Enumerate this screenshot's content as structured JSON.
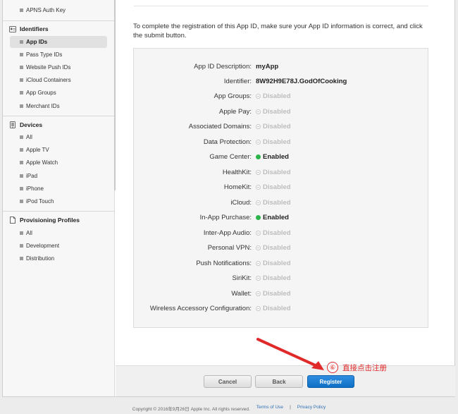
{
  "sidebar": {
    "top_items": [
      {
        "label": "APNS Auth Key"
      }
    ],
    "identifiers": {
      "title": "Identifiers",
      "items": [
        {
          "label": "App IDs",
          "active": true
        },
        {
          "label": "Pass Type IDs"
        },
        {
          "label": "Website Push IDs"
        },
        {
          "label": "iCloud Containers"
        },
        {
          "label": "App Groups"
        },
        {
          "label": "Merchant IDs"
        }
      ]
    },
    "devices": {
      "title": "Devices",
      "items": [
        {
          "label": "All"
        },
        {
          "label": "Apple TV"
        },
        {
          "label": "Apple Watch"
        },
        {
          "label": "iPad"
        },
        {
          "label": "iPhone"
        },
        {
          "label": "iPod Touch"
        }
      ]
    },
    "profiles": {
      "title": "Provisioning Profiles",
      "items": [
        {
          "label": "All"
        },
        {
          "label": "Development"
        },
        {
          "label": "Distribution"
        }
      ]
    }
  },
  "main": {
    "intro": "To complete the registration of this App ID, make sure your App ID information is correct, and click the submit button.",
    "details": [
      {
        "key": "App ID Description:",
        "value": "myApp"
      },
      {
        "key": "Identifier:",
        "value": "8W92H9E78J.GodOfCooking"
      }
    ],
    "services": [
      {
        "key": "App Groups:",
        "status": "Disabled"
      },
      {
        "key": "Apple Pay:",
        "status": "Disabled"
      },
      {
        "key": "Associated Domains:",
        "status": "Disabled"
      },
      {
        "key": "Data Protection:",
        "status": "Disabled"
      },
      {
        "key": "Game Center:",
        "status": "Enabled"
      },
      {
        "key": "HealthKit:",
        "status": "Disabled"
      },
      {
        "key": "HomeKit:",
        "status": "Disabled"
      },
      {
        "key": "iCloud:",
        "status": "Disabled"
      },
      {
        "key": "In-App Purchase:",
        "status": "Enabled"
      },
      {
        "key": "Inter-App Audio:",
        "status": "Disabled"
      },
      {
        "key": "Personal VPN:",
        "status": "Disabled"
      },
      {
        "key": "Push Notifications:",
        "status": "Disabled"
      },
      {
        "key": "SiriKit:",
        "status": "Disabled"
      },
      {
        "key": "Wallet:",
        "status": "Disabled"
      },
      {
        "key": "Wireless Accessory Configuration:",
        "status": "Disabled"
      }
    ],
    "buttons": {
      "cancel": "Cancel",
      "back": "Back",
      "register": "Register"
    }
  },
  "annotation": {
    "step": "⑥",
    "text": "直接点击注册"
  },
  "footer": {
    "copyright": "Copyright © 2016年9月26日 Apple Inc. All rights reserved.",
    "terms": "Terms of Use",
    "sep": "|",
    "privacy": "Privacy Policy"
  },
  "colors": {
    "enabled": "#2cb34a",
    "disabled": "#bdbdbd",
    "primary_button": "#1a7fd4",
    "annotation": "#e02a2a"
  }
}
